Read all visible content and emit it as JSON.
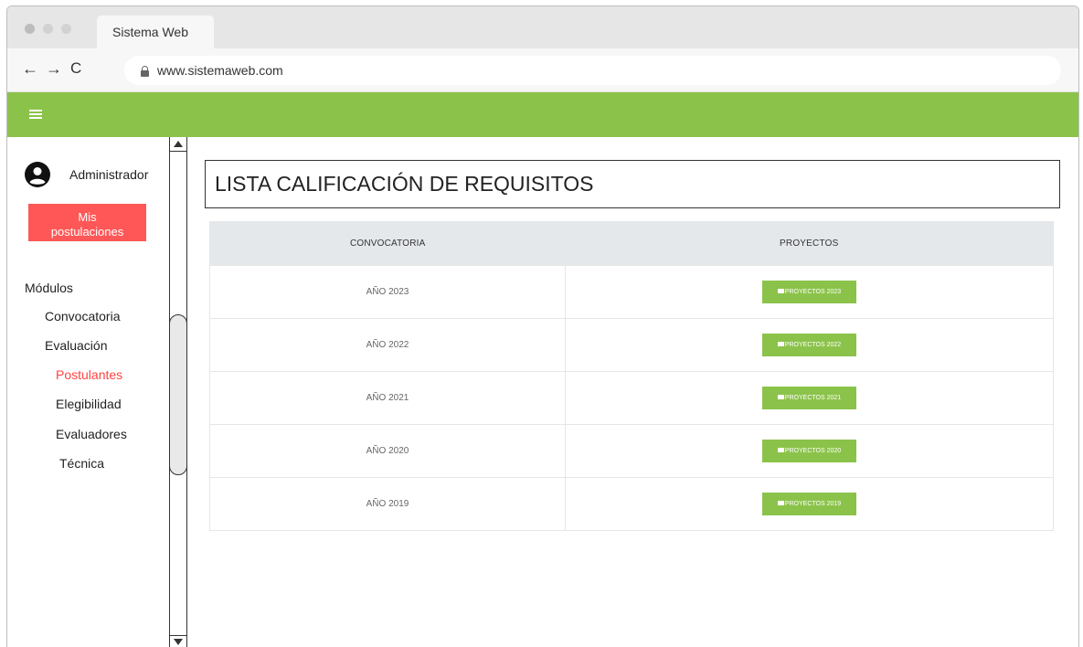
{
  "browser": {
    "tab_title": "Sistema Web",
    "url": "www.sistemaweb.com",
    "nav": {
      "back": "←",
      "forward": "→",
      "reload": "C"
    }
  },
  "colors": {
    "accent_green": "#8bc34a",
    "danger_red": "#ff5757",
    "active_link": "#ff4444"
  },
  "sidebar": {
    "user_name": "Administrador",
    "mis_postulaciones": [
      "Mis",
      "postulaciones"
    ],
    "modules_label": "Módulos",
    "items": [
      {
        "label": "Convocatoria"
      },
      {
        "label": "Evaluación"
      },
      {
        "label": "Postulantes",
        "active": true
      },
      {
        "label": "Elegibilidad"
      },
      {
        "label": "Evaluadores"
      },
      {
        "label": "Técnica"
      }
    ]
  },
  "main": {
    "title": "LISTA CALIFICACIÓN DE REQUISITOS",
    "table": {
      "headers": [
        "CONVOCATORIA",
        "PROYECTOS"
      ],
      "rows": [
        {
          "convocatoria": "AÑO 2023",
          "button": "PROYECTOS 2023"
        },
        {
          "convocatoria": "AÑO 2022",
          "button": "PROYECTOS 2022"
        },
        {
          "convocatoria": "AÑO 2021",
          "button": "PROYECTOS 2021"
        },
        {
          "convocatoria": "AÑO 2020",
          "button": "PROYECTOS 2020"
        },
        {
          "convocatoria": "AÑO 2019",
          "button": "PROYECTOS 2019"
        }
      ]
    }
  }
}
